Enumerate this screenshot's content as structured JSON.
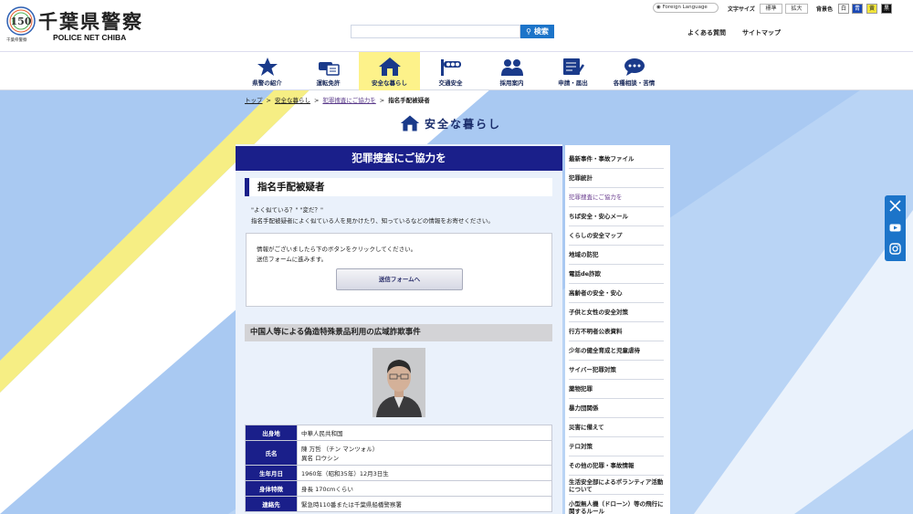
{
  "header": {
    "logo_title": "千葉県警察",
    "logo_sub": "POLICE NET CHIBA",
    "logo_badge": "150",
    "logo_caption": "千葉県警察",
    "search_button": "検索",
    "search_placeholder": "",
    "foreign_language": "Foreign Language",
    "font_size_label": "文字サイズ",
    "font_size_normal": "標準",
    "font_size_large": "拡大",
    "bg_color_label": "背景色",
    "bg_white": "白",
    "bg_blue": "青",
    "bg_yellow": "黄",
    "bg_black": "黒",
    "faq": "よくある質問",
    "sitemap": "サイトマップ"
  },
  "nav": [
    {
      "label": "県警の紹介",
      "icon": "emblem-icon"
    },
    {
      "label": "運転免許",
      "icon": "license-icon"
    },
    {
      "label": "安全な暮らし",
      "icon": "house-icon"
    },
    {
      "label": "交通安全",
      "icon": "traffic-icon"
    },
    {
      "label": "採用案内",
      "icon": "recruit-icon"
    },
    {
      "label": "申請・届出",
      "icon": "application-icon"
    },
    {
      "label": "各種相談・苦情",
      "icon": "consult-icon"
    }
  ],
  "breadcrumb": {
    "top": "トップ",
    "safe": "安全な暮らし",
    "cooperate": "犯罪捜査にご協力を",
    "current": "指名手配被疑者",
    "sep": ">"
  },
  "section_title": "安全な暮らし",
  "main": {
    "banner": "犯罪捜査にご協力を",
    "heading": "指名手配被疑者",
    "intro_1": "\"よく似ている？\" \"変だ？\"",
    "intro_2": "指名手配被疑者によく似ている人を見かけたり、知っているなどの情報をお寄せください。",
    "notice_1": "情報がございましたら下のボタンをクリックしてください。",
    "notice_2": "送信フォームに進みます。",
    "form_button": "送信フォームへ",
    "case_title": "中国人等による偽造特殊景品利用の広域詐欺事件",
    "table": [
      {
        "key": "出身地",
        "value": "中華人民共和国"
      },
      {
        "key": "氏名",
        "value": "陳 万哲 （チン マンツォル）",
        "value2": "異名 ロウシン"
      },
      {
        "key": "生年月日",
        "value": "1960年（昭和35年）12月3日生"
      },
      {
        "key": "身体特徴",
        "value": "身長 170cmくらい"
      },
      {
        "key": "連絡先",
        "value": "緊急時110番または千葉県船橋警察署"
      }
    ]
  },
  "sidebar": [
    "最新事件・事故ファイル",
    "犯罪統計",
    "犯罪捜査にご協力を",
    "ちば安全・安心メール",
    "くらしの安全マップ",
    "地域の防犯",
    "電話de詐欺",
    "高齢者の安全・安心",
    "子供と女性の安全対策",
    "行方不明者公表資料",
    "少年の健全育成と児童虐待",
    "サイバー犯罪対策",
    "薬物犯罪",
    "暴力団関係",
    "災害に備えて",
    "テロ対策",
    "その他の犯罪・事故情報",
    "生活安全部によるボランティア活動について",
    "小型無人機（ドローン）等の飛行に関するルール"
  ],
  "social": [
    "x-icon",
    "youtube-icon",
    "instagram-icon"
  ],
  "colors": {
    "navy": "#1a1f8a",
    "accent_blue": "#1c74c9",
    "nav_active": "#fdf28a",
    "bg_blue": "#a9c9f2"
  }
}
